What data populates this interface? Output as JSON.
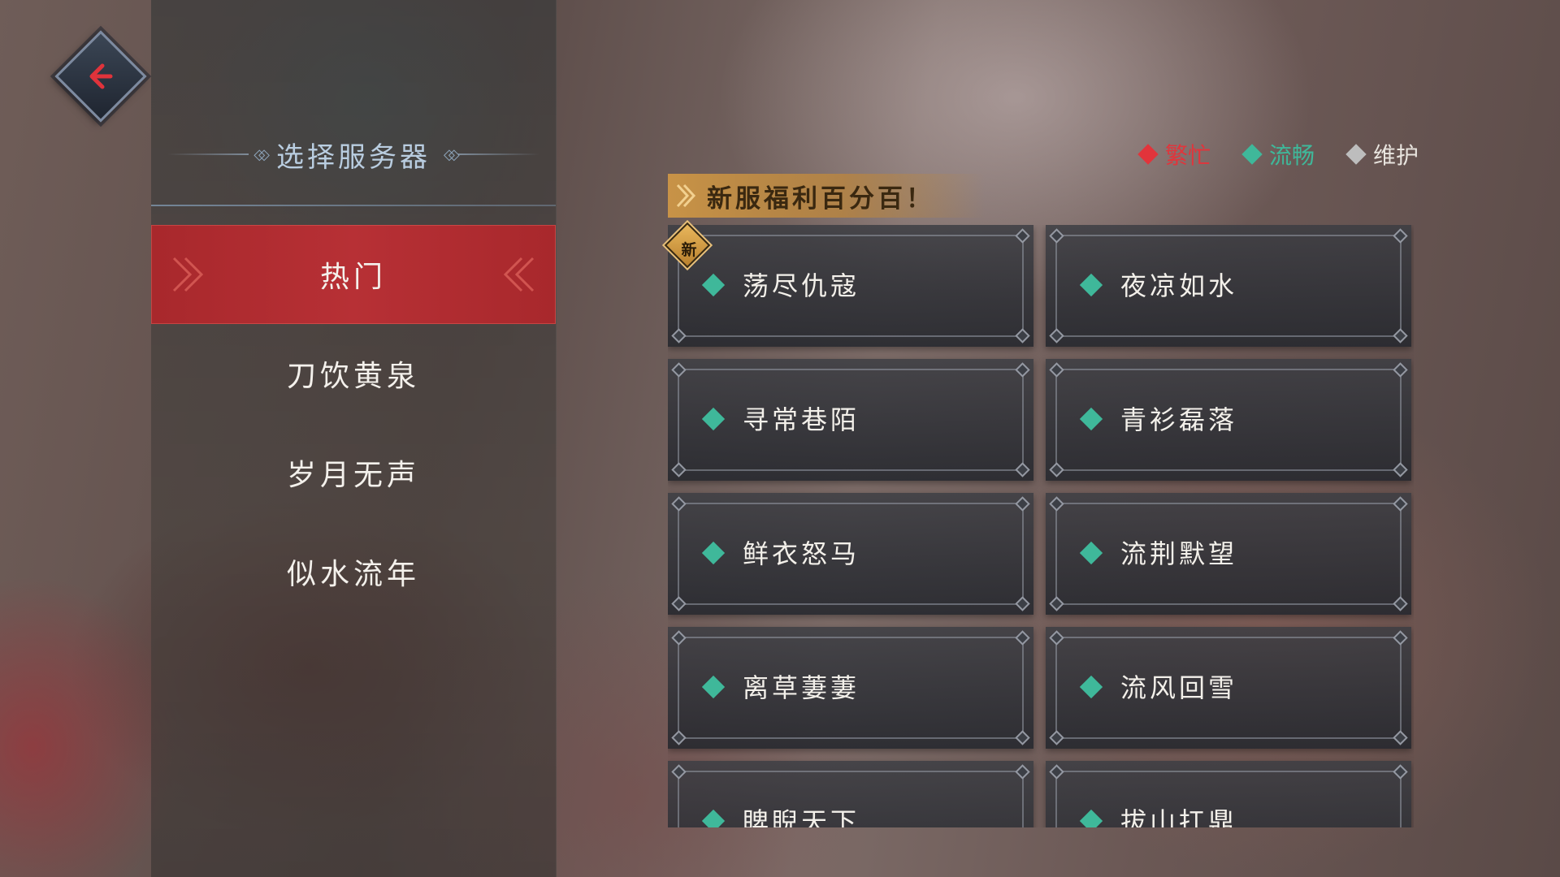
{
  "header": {
    "title": "选择服务器"
  },
  "status_legend": [
    {
      "label": "繁忙",
      "color": "#e2343b"
    },
    {
      "label": "流畅",
      "color": "#3fb89a"
    },
    {
      "label": "维护",
      "color": "#bdbdbd"
    }
  ],
  "categories": [
    {
      "label": "热门",
      "selected": true
    },
    {
      "label": "刀饮黄泉",
      "selected": false
    },
    {
      "label": "岁月无声",
      "selected": false
    },
    {
      "label": "似水流年",
      "selected": false
    }
  ],
  "promo": {
    "text": "新服福利百分百！"
  },
  "new_badge": "新",
  "servers": [
    {
      "name": "荡尽仇寇",
      "status": "流畅",
      "is_new": true
    },
    {
      "name": "夜凉如水",
      "status": "流畅",
      "is_new": false
    },
    {
      "name": "寻常巷陌",
      "status": "流畅",
      "is_new": false
    },
    {
      "name": "青衫磊落",
      "status": "流畅",
      "is_new": false
    },
    {
      "name": "鲜衣怒马",
      "status": "流畅",
      "is_new": false
    },
    {
      "name": "流荆默望",
      "status": "流畅",
      "is_new": false
    },
    {
      "name": "离草萋萋",
      "status": "流畅",
      "is_new": false
    },
    {
      "name": "流风回雪",
      "status": "流畅",
      "is_new": false
    },
    {
      "name": "睥睨天下",
      "status": "流畅",
      "is_new": false
    },
    {
      "name": "拔山扛鼎",
      "status": "流畅",
      "is_new": false
    }
  ],
  "colors": {
    "accent_red": "#b73035",
    "promo_gold": "#cd9646",
    "status_smooth": "#3fb89a"
  },
  "icons": {
    "back": "back-arrow-icon",
    "status": "diamond-icon"
  }
}
